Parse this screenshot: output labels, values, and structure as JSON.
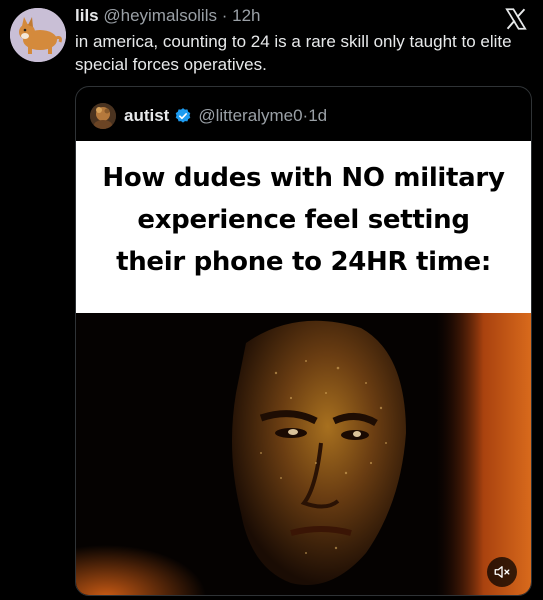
{
  "tweet": {
    "author_name": "lils",
    "author_handle": "@heyimalsolils",
    "separator": "·",
    "time": "12h",
    "text": "in america, counting to 24 is a rare skill only taught to elite special forces operatives.",
    "avatar_icon": "corgi-avatar-icon",
    "logo_icon": "x-logo-icon"
  },
  "quote": {
    "author_name": "autist",
    "author_handle": "@litteralyme0",
    "separator": "·",
    "time": "1d",
    "verified_icon": "verified-badge-icon",
    "media": {
      "caption_lines": [
        "How dudes with NO military",
        "experience feel setting",
        "their phone to 24HR time:"
      ],
      "mute_icon": "speaker-muted-icon"
    }
  },
  "colors": {
    "background": "#000000",
    "text_primary": "#e7e9ea",
    "text_secondary": "#9aa0a6",
    "border": "#2f3336",
    "verified": "#1d9bf0"
  }
}
